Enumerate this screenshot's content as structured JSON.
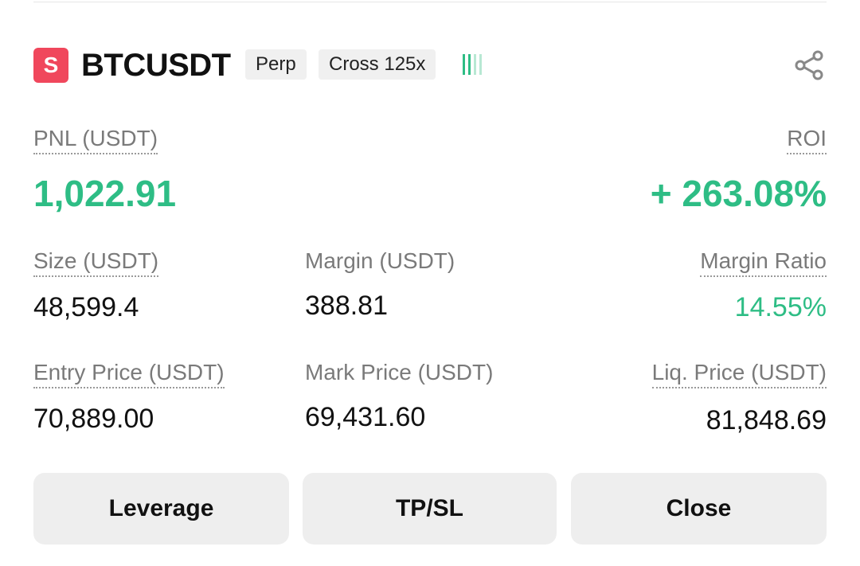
{
  "header": {
    "side_badge": "S",
    "symbol": "BTCUSDT",
    "tags": [
      "Perp",
      "Cross 125x"
    ],
    "signal_icon": "signal-bars-icon",
    "share_icon": "share-icon"
  },
  "pnl": {
    "label": "PNL (USDT)",
    "value": "1,022.91"
  },
  "roi": {
    "label": "ROI",
    "value": "+ 263.08%"
  },
  "size": {
    "label": "Size (USDT)",
    "value": "48,599.4"
  },
  "margin": {
    "label": "Margin (USDT)",
    "value": "388.81"
  },
  "margin_ratio": {
    "label": "Margin Ratio",
    "value": "14.55%"
  },
  "entry_price": {
    "label": "Entry Price (USDT)",
    "value": "70,889.00"
  },
  "mark_price": {
    "label": "Mark Price (USDT)",
    "value": "69,431.60"
  },
  "liq_price": {
    "label": "Liq. Price (USDT)",
    "value": "81,848.69"
  },
  "buttons": {
    "leverage": "Leverage",
    "tpsl": "TP/SL",
    "close": "Close"
  },
  "colors": {
    "profit_green": "#2ebd85",
    "side_badge": "#f0475c",
    "button_bg": "#eeeeee"
  }
}
